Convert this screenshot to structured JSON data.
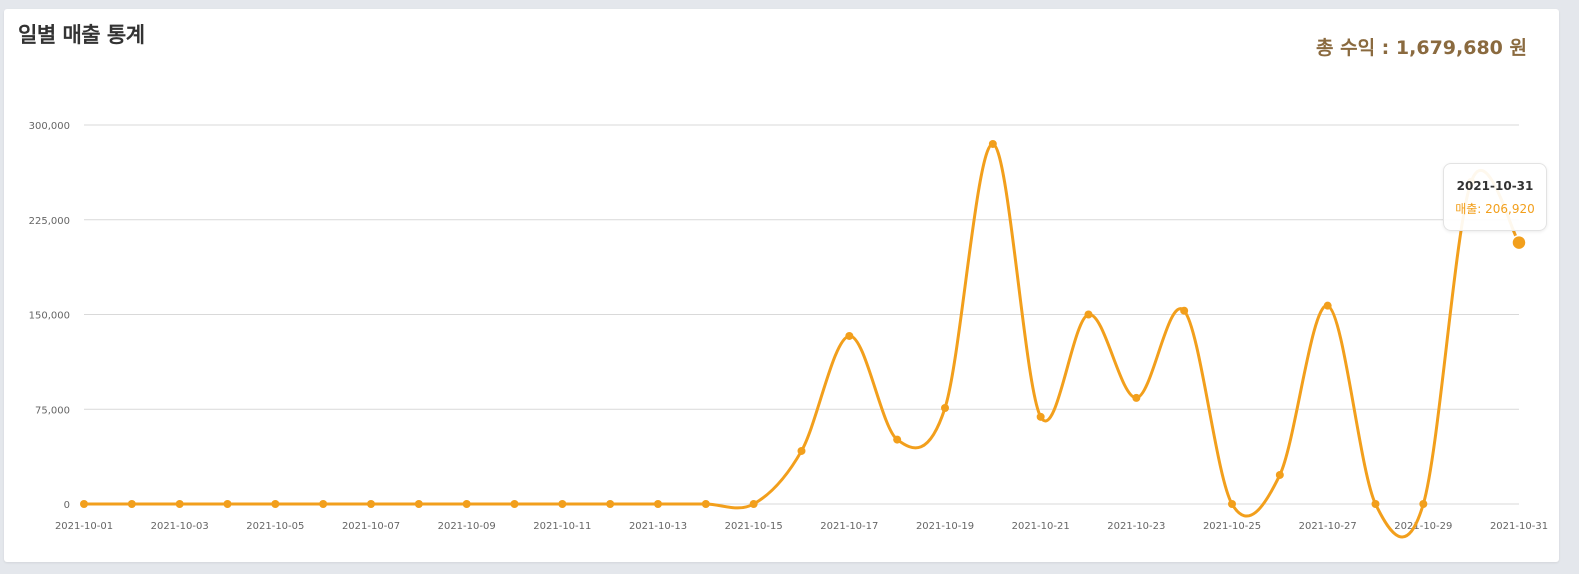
{
  "header": {
    "title": "일별 매출 통계",
    "total_label": "총 수익 :",
    "total_value": "1,679,680",
    "total_unit": "원"
  },
  "colors": {
    "series": "#f29f1c",
    "grid": "#d9d9d9",
    "axis_text": "#666666",
    "total_text": "#8a6a3f"
  },
  "chart_data": {
    "type": "line",
    "title": "일별 매출 통계",
    "xlabel": "",
    "ylabel": "",
    "ylim": [
      0,
      300000
    ],
    "yticks": [
      0,
      75000,
      150000,
      225000,
      300000
    ],
    "ytick_labels": [
      "0",
      "75,000",
      "150,000",
      "225,000",
      "300,000"
    ],
    "grid": true,
    "smooth": true,
    "x": [
      "2021-10-01",
      "2021-10-02",
      "2021-10-03",
      "2021-10-04",
      "2021-10-05",
      "2021-10-06",
      "2021-10-07",
      "2021-10-08",
      "2021-10-09",
      "2021-10-10",
      "2021-10-11",
      "2021-10-12",
      "2021-10-13",
      "2021-10-14",
      "2021-10-15",
      "2021-10-16",
      "2021-10-17",
      "2021-10-18",
      "2021-10-19",
      "2021-10-20",
      "2021-10-21",
      "2021-10-22",
      "2021-10-23",
      "2021-10-24",
      "2021-10-25",
      "2021-10-26",
      "2021-10-27",
      "2021-10-28",
      "2021-10-29",
      "2021-10-30",
      "2021-10-31"
    ],
    "xtick_labels": [
      "2021-10-01",
      "2021-10-03",
      "2021-10-05",
      "2021-10-07",
      "2021-10-09",
      "2021-10-11",
      "2021-10-13",
      "2021-10-15",
      "2021-10-17",
      "2021-10-19",
      "2021-10-21",
      "2021-10-23",
      "2021-10-25",
      "2021-10-27",
      "2021-10-29",
      "2021-10-31"
    ],
    "series": [
      {
        "name": "매출",
        "values": [
          0,
          0,
          0,
          0,
          0,
          0,
          0,
          0,
          0,
          0,
          0,
          0,
          0,
          0,
          0,
          42000,
          133000,
          51000,
          76000,
          285000,
          69000,
          150000,
          84000,
          153000,
          0,
          23000,
          157000,
          0,
          0,
          255000,
          206920
        ]
      }
    ],
    "tooltip": {
      "date": "2021-10-31",
      "label": "매출: 206,920"
    }
  }
}
